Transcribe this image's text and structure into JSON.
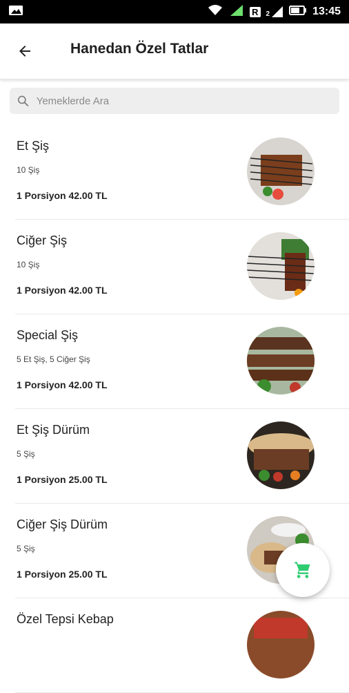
{
  "status_bar": {
    "time": "13:45",
    "sim_label": "R",
    "network_label": "2"
  },
  "header": {
    "title": "Hanedan Özel Tatlar"
  },
  "search": {
    "placeholder": "Yemeklerde Ara"
  },
  "items": [
    {
      "name": "Et Şiş",
      "description": "10 Şiş",
      "price": "1 Porsiyon  42.00 TL"
    },
    {
      "name": "Ciğer Şiş",
      "description": "10 Şiş",
      "price": "1 Porsiyon  42.00 TL"
    },
    {
      "name": "Special Şiş",
      "description": "5 Et Şiş, 5 Ciğer Şiş",
      "price": "1 Porsiyon  42.00 TL"
    },
    {
      "name": "Et Şiş Dürüm",
      "description": "5 Şiş",
      "price": "1 Porsiyon  25.00 TL"
    },
    {
      "name": "Ciğer Şiş Dürüm",
      "description": "5 Şiş",
      "price": "1 Porsiyon  25.00 TL"
    },
    {
      "name": "Özel Tepsi Kebap"
    }
  ],
  "fab": {
    "icon": "cart-icon",
    "color": "#2ecc71"
  }
}
